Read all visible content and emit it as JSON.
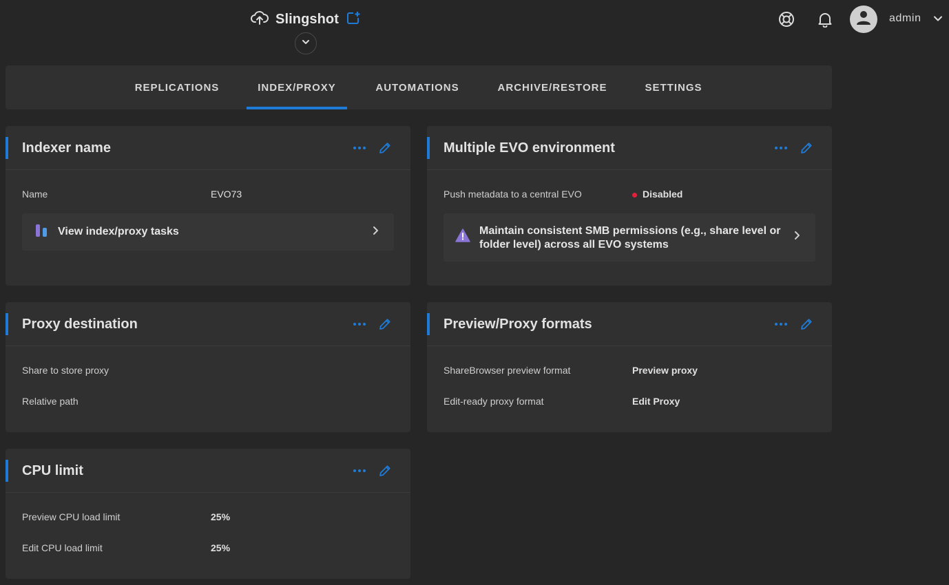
{
  "header": {
    "app_title": "Slingshot",
    "username": "admin"
  },
  "tabs": [
    {
      "label": "REPLICATIONS"
    },
    {
      "label": "INDEX/PROXY",
      "active": true
    },
    {
      "label": "AUTOMATIONS"
    },
    {
      "label": "ARCHIVE/RESTORE"
    },
    {
      "label": "SETTINGS"
    }
  ],
  "cards": {
    "indexer": {
      "title": "Indexer name",
      "name_label": "Name",
      "name_value": "EVO73",
      "link_label": "View index/proxy tasks"
    },
    "multi_evo": {
      "title": "Multiple EVO environment",
      "push_label": "Push metadata to a central EVO",
      "push_value": "Disabled",
      "warning_text": "Maintain consistent SMB permissions (e.g., share level or folder level) across all EVO systems"
    },
    "proxy_dest": {
      "title": "Proxy destination",
      "share_label": "Share to store proxy",
      "path_label": "Relative path"
    },
    "formats": {
      "title": "Preview/Proxy formats",
      "preview_label": "ShareBrowser preview format",
      "preview_value": "Preview proxy",
      "edit_label": "Edit-ready proxy format",
      "edit_value": "Edit Proxy"
    },
    "cpu": {
      "title": "CPU limit",
      "preview_label": "Preview CPU load limit",
      "preview_value": "25%",
      "edit_label": "Edit CPU load limit",
      "edit_value": "25%"
    }
  },
  "colors": {
    "accent": "#1e7bd7",
    "status_disabled": "#e0213c",
    "warning_icon": "#8a74d6"
  },
  "icons": {
    "app": "cloud-upload-icon",
    "app_action": "new-window-icon",
    "support": "lifebuoy-icon",
    "notifications": "bell-icon",
    "avatar": "person-icon",
    "more": "more-horizontal-icon",
    "edit": "pencil-icon",
    "tasks": "tasks-icon",
    "warning": "warning-triangle-icon",
    "chevron": "chevron-right-icon"
  }
}
